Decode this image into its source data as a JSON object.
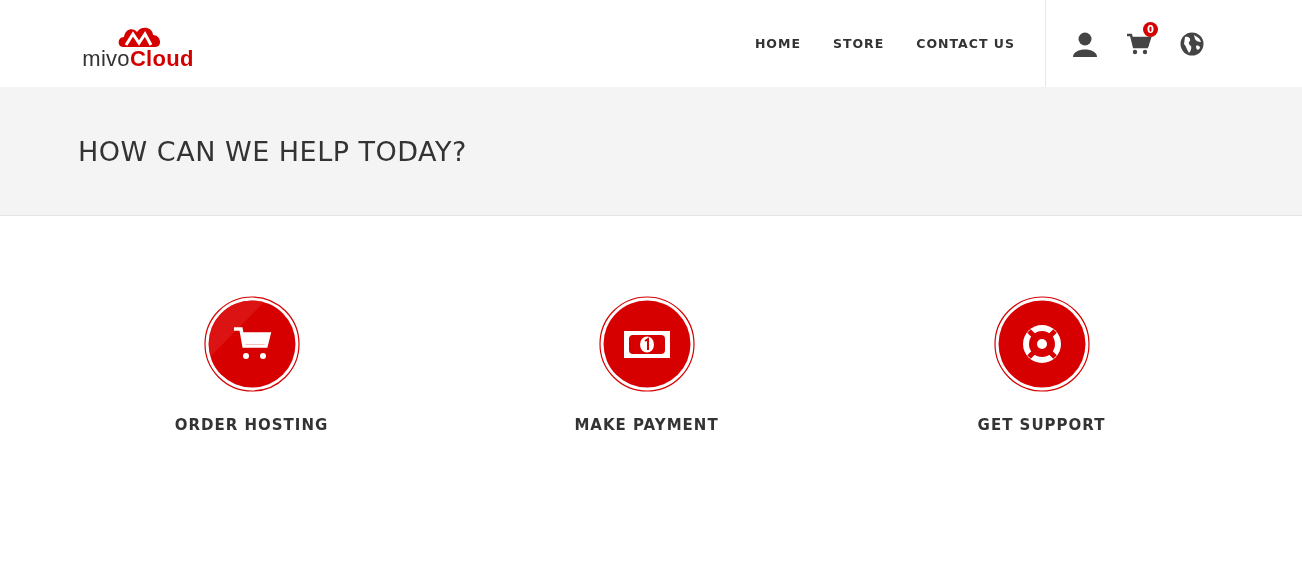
{
  "logo": {
    "text": "mivo**Cloud**"
  },
  "nav": [
    {
      "label": "HOME"
    },
    {
      "label": "STORE"
    },
    {
      "label": "CONTACT US"
    }
  ],
  "cart": {
    "count": "0"
  },
  "hero": {
    "title": "HOW CAN WE HELP TODAY?"
  },
  "actions": [
    {
      "kind": "cart",
      "label": "ORDER HOSTING"
    },
    {
      "kind": "money",
      "label": "MAKE PAYMENT"
    },
    {
      "kind": "support",
      "label": "GET SUPPORT"
    }
  ]
}
